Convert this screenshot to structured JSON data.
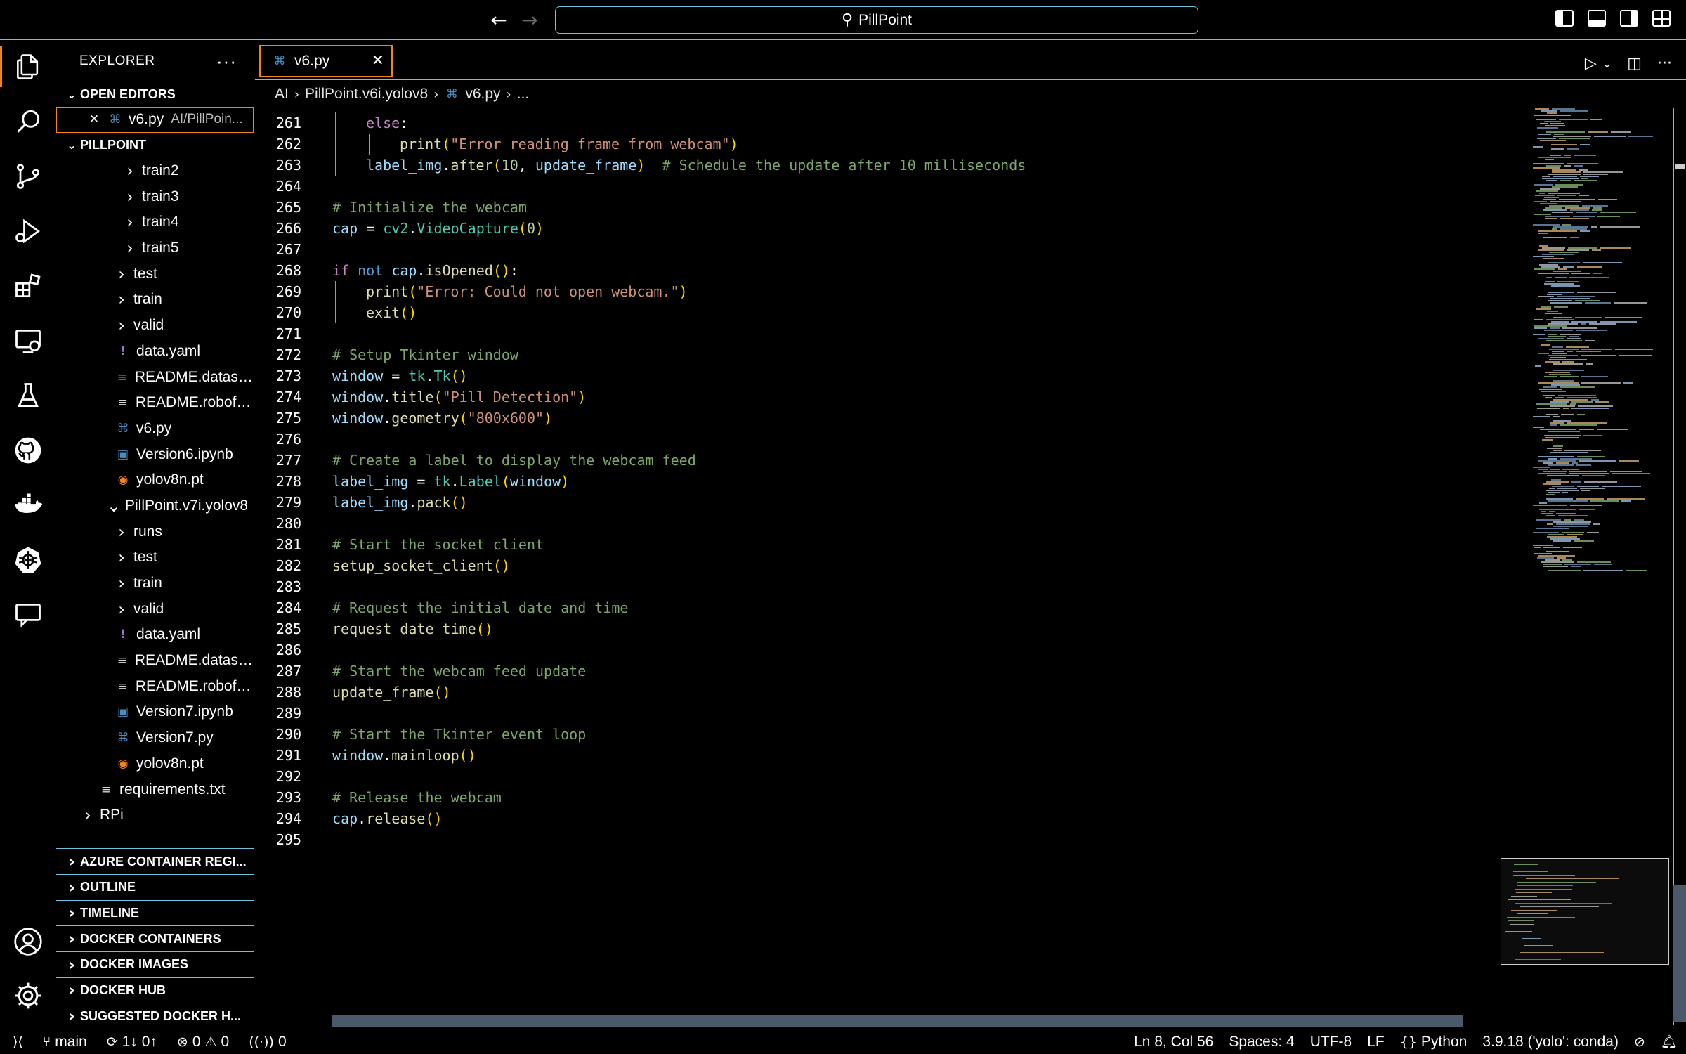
{
  "window": {
    "title": "PillPoint"
  },
  "explorer": {
    "title": "EXPLORER",
    "more": "···",
    "open_editors": {
      "label": "OPEN EDITORS",
      "items": [
        {
          "name": "v6.py",
          "path": "AI/PillPoin..."
        }
      ]
    },
    "project": {
      "label": "PILLPOINT",
      "tree": [
        {
          "name": "train2",
          "kind": "folder"
        },
        {
          "name": "train3",
          "kind": "folder"
        },
        {
          "name": "train4",
          "kind": "folder"
        },
        {
          "name": "train5",
          "kind": "folder"
        },
        {
          "name": "test",
          "kind": "folder"
        },
        {
          "name": "train",
          "kind": "folder"
        },
        {
          "name": "valid",
          "kind": "folder"
        },
        {
          "name": "data.yaml",
          "kind": "yaml"
        },
        {
          "name": "README.dataset....",
          "kind": "md"
        },
        {
          "name": "README.roboflo...",
          "kind": "md"
        },
        {
          "name": "v6.py",
          "kind": "py"
        },
        {
          "name": "Version6.ipynb",
          "kind": "nb"
        },
        {
          "name": "yolov8n.pt",
          "kind": "pt"
        },
        {
          "name": "PillPoint.v7i.yolov8",
          "kind": "folder-open"
        },
        {
          "name": "runs",
          "kind": "folder"
        },
        {
          "name": "test",
          "kind": "folder"
        },
        {
          "name": "train",
          "kind": "folder"
        },
        {
          "name": "valid",
          "kind": "folder"
        },
        {
          "name": "data.yaml",
          "kind": "yaml"
        },
        {
          "name": "README.dataset....",
          "kind": "md"
        },
        {
          "name": "README.roboflo...",
          "kind": "md"
        },
        {
          "name": "Version7.ipynb",
          "kind": "nb"
        },
        {
          "name": "Version7.py",
          "kind": "py"
        },
        {
          "name": "yolov8n.pt",
          "kind": "pt"
        },
        {
          "name": "requirements.txt",
          "kind": "md"
        },
        {
          "name": "RPi",
          "kind": "folder"
        }
      ]
    },
    "sections": [
      "AZURE CONTAINER REGI...",
      "OUTLINE",
      "TIMELINE",
      "DOCKER CONTAINERS",
      "DOCKER IMAGES",
      "DOCKER HUB",
      "SUGGESTED DOCKER H..."
    ]
  },
  "tab": {
    "label": "v6.py",
    "close": "✕"
  },
  "breadcrumb": [
    "AI",
    "PillPoint.v6i.yolov8",
    "v6.py",
    "..."
  ],
  "code": {
    "lines": [
      {
        "n": "261",
        "indent": 1,
        "tokens": [
          [
            "kwf",
            "else"
          ],
          [
            "pl",
            ":"
          ]
        ]
      },
      {
        "n": "262",
        "indent": 2,
        "tokens": [
          [
            "fn",
            "print"
          ],
          [
            "par",
            "("
          ],
          [
            "str",
            "\"Error reading frame from webcam\""
          ],
          [
            "par",
            ")"
          ]
        ]
      },
      {
        "n": "263",
        "indent": 1,
        "tokens": [
          [
            "var",
            "label_img"
          ],
          [
            "pl",
            "."
          ],
          [
            "fn",
            "after"
          ],
          [
            "par",
            "("
          ],
          [
            "num",
            "10"
          ],
          [
            "pl",
            ", "
          ],
          [
            "var",
            "update_frame"
          ],
          [
            "par",
            ")"
          ],
          [
            "pl",
            "  "
          ],
          [
            "cm",
            "# Schedule the update after 10 milliseconds"
          ]
        ]
      },
      {
        "n": "264",
        "indent": 0,
        "tokens": []
      },
      {
        "n": "265",
        "indent": 0,
        "tokens": [
          [
            "cm",
            "# Initialize the webcam"
          ]
        ]
      },
      {
        "n": "266",
        "indent": 0,
        "tokens": [
          [
            "var",
            "cap"
          ],
          [
            "pl",
            " = "
          ],
          [
            "cls",
            "cv2"
          ],
          [
            "pl",
            "."
          ],
          [
            "cls",
            "VideoCapture"
          ],
          [
            "par",
            "("
          ],
          [
            "num",
            "0"
          ],
          [
            "par",
            ")"
          ]
        ]
      },
      {
        "n": "267",
        "indent": 0,
        "tokens": []
      },
      {
        "n": "268",
        "indent": 0,
        "tokens": [
          [
            "kwf",
            "if"
          ],
          [
            "pl",
            " "
          ],
          [
            "kw",
            "not"
          ],
          [
            "pl",
            " "
          ],
          [
            "var",
            "cap"
          ],
          [
            "pl",
            "."
          ],
          [
            "fn",
            "isOpened"
          ],
          [
            "par",
            "()"
          ],
          [
            "pl",
            ":"
          ]
        ]
      },
      {
        "n": "269",
        "indent": 1,
        "tokens": [
          [
            "fn",
            "print"
          ],
          [
            "par",
            "("
          ],
          [
            "str",
            "\"Error: Could not open webcam.\""
          ],
          [
            "par",
            ")"
          ]
        ]
      },
      {
        "n": "270",
        "indent": 1,
        "tokens": [
          [
            "fn",
            "exit"
          ],
          [
            "par",
            "()"
          ]
        ]
      },
      {
        "n": "271",
        "indent": 0,
        "tokens": []
      },
      {
        "n": "272",
        "indent": 0,
        "tokens": [
          [
            "cm",
            "# Setup Tkinter window"
          ]
        ]
      },
      {
        "n": "273",
        "indent": 0,
        "tokens": [
          [
            "var",
            "window"
          ],
          [
            "pl",
            " = "
          ],
          [
            "cls",
            "tk"
          ],
          [
            "pl",
            "."
          ],
          [
            "cls",
            "Tk"
          ],
          [
            "par",
            "()"
          ]
        ]
      },
      {
        "n": "274",
        "indent": 0,
        "tokens": [
          [
            "var",
            "window"
          ],
          [
            "pl",
            "."
          ],
          [
            "fn",
            "title"
          ],
          [
            "par",
            "("
          ],
          [
            "str",
            "\"Pill Detection\""
          ],
          [
            "par",
            ")"
          ]
        ]
      },
      {
        "n": "275",
        "indent": 0,
        "tokens": [
          [
            "var",
            "window"
          ],
          [
            "pl",
            "."
          ],
          [
            "fn",
            "geometry"
          ],
          [
            "par",
            "("
          ],
          [
            "str",
            "\"800x600\""
          ],
          [
            "par",
            ")"
          ]
        ]
      },
      {
        "n": "276",
        "indent": 0,
        "tokens": []
      },
      {
        "n": "277",
        "indent": 0,
        "tokens": [
          [
            "cm",
            "# Create a label to display the webcam feed"
          ]
        ]
      },
      {
        "n": "278",
        "indent": 0,
        "tokens": [
          [
            "var",
            "label_img"
          ],
          [
            "pl",
            " = "
          ],
          [
            "cls",
            "tk"
          ],
          [
            "pl",
            "."
          ],
          [
            "cls",
            "Label"
          ],
          [
            "par",
            "("
          ],
          [
            "var",
            "window"
          ],
          [
            "par",
            ")"
          ]
        ]
      },
      {
        "n": "279",
        "indent": 0,
        "tokens": [
          [
            "var",
            "label_img"
          ],
          [
            "pl",
            "."
          ],
          [
            "fn",
            "pack"
          ],
          [
            "par",
            "()"
          ]
        ]
      },
      {
        "n": "280",
        "indent": 0,
        "tokens": []
      },
      {
        "n": "281",
        "indent": 0,
        "tokens": [
          [
            "cm",
            "# Start the socket client"
          ]
        ]
      },
      {
        "n": "282",
        "indent": 0,
        "tokens": [
          [
            "fn",
            "setup_socket_client"
          ],
          [
            "par",
            "()"
          ]
        ]
      },
      {
        "n": "283",
        "indent": 0,
        "tokens": []
      },
      {
        "n": "284",
        "indent": 0,
        "tokens": [
          [
            "cm",
            "# Request the initial date and time"
          ]
        ]
      },
      {
        "n": "285",
        "indent": 0,
        "tokens": [
          [
            "fn",
            "request_date_time"
          ],
          [
            "par",
            "()"
          ]
        ]
      },
      {
        "n": "286",
        "indent": 0,
        "tokens": []
      },
      {
        "n": "287",
        "indent": 0,
        "tokens": [
          [
            "cm",
            "# Start the webcam feed update"
          ]
        ]
      },
      {
        "n": "288",
        "indent": 0,
        "tokens": [
          [
            "fn",
            "update_frame"
          ],
          [
            "par",
            "()"
          ]
        ]
      },
      {
        "n": "289",
        "indent": 0,
        "tokens": []
      },
      {
        "n": "290",
        "indent": 0,
        "tokens": [
          [
            "cm",
            "# Start the Tkinter event loop"
          ]
        ]
      },
      {
        "n": "291",
        "indent": 0,
        "tokens": [
          [
            "var",
            "window"
          ],
          [
            "pl",
            "."
          ],
          [
            "fn",
            "mainloop"
          ],
          [
            "par",
            "()"
          ]
        ]
      },
      {
        "n": "292",
        "indent": 0,
        "tokens": []
      },
      {
        "n": "293",
        "indent": 0,
        "tokens": [
          [
            "cm",
            "# Release the webcam"
          ]
        ]
      },
      {
        "n": "294",
        "indent": 0,
        "tokens": [
          [
            "var",
            "cap"
          ],
          [
            "pl",
            "."
          ],
          [
            "fn",
            "release"
          ],
          [
            "par",
            "()"
          ]
        ]
      },
      {
        "n": "295",
        "indent": 0,
        "tokens": []
      }
    ]
  },
  "statusbar": {
    "branch": "main",
    "sync": "1↓ 0↑",
    "errors": "0",
    "warnings": "0",
    "ports": "0",
    "position": "Ln 8, Col 56",
    "spaces": "Spaces: 4",
    "encoding": "UTF-8",
    "eol": "LF",
    "language": "Python",
    "interpreter": "3.9.18 ('yolo': conda)"
  },
  "colors": {
    "border": "#6fc3df",
    "active": "#f38518",
    "background": "#000000"
  }
}
